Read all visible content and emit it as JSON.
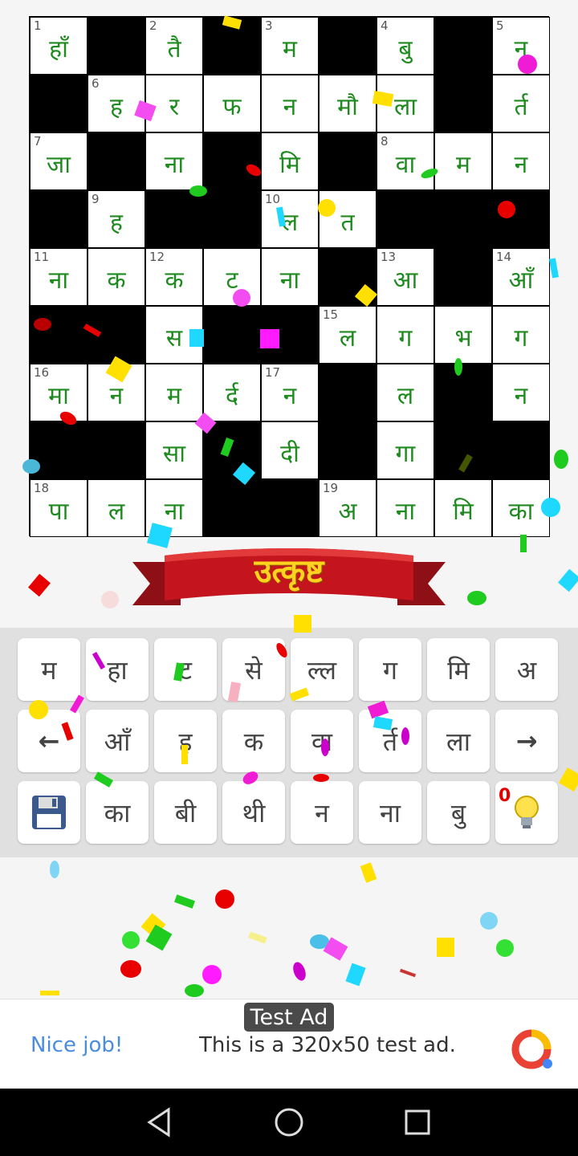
{
  "crossword": {
    "rows": [
      [
        {
          "n": "1",
          "ch": "हाँ"
        },
        null,
        {
          "n": "2",
          "ch": "तै"
        },
        null,
        {
          "n": "3",
          "ch": "म"
        },
        null,
        {
          "n": "4",
          "ch": "बु"
        },
        null,
        {
          "n": "5",
          "ch": "न"
        }
      ],
      [
        null,
        {
          "n": "6",
          "ch": "ह"
        },
        {
          "n": "",
          "ch": "र"
        },
        {
          "n": "",
          "ch": "फ"
        },
        {
          "n": "",
          "ch": "न"
        },
        {
          "n": "",
          "ch": "मौ"
        },
        {
          "n": "",
          "ch": "ला"
        },
        null,
        {
          "n": "",
          "ch": "र्त"
        }
      ],
      [
        {
          "n": "7",
          "ch": "जा"
        },
        null,
        {
          "n": "",
          "ch": "ना"
        },
        null,
        {
          "n": "",
          "ch": "मि"
        },
        null,
        {
          "n": "8",
          "ch": "वा"
        },
        {
          "n": "",
          "ch": "म"
        },
        {
          "n": "",
          "ch": "न"
        }
      ],
      [
        null,
        {
          "n": "9",
          "ch": "ह"
        },
        null,
        null,
        {
          "n": "10",
          "ch": "ल"
        },
        {
          "n": "",
          "ch": "त"
        },
        null,
        null,
        null
      ],
      [
        {
          "n": "11",
          "ch": "ना"
        },
        {
          "n": "",
          "ch": "क"
        },
        {
          "n": "12",
          "ch": "क"
        },
        {
          "n": "",
          "ch": "ट"
        },
        {
          "n": "",
          "ch": "ना"
        },
        null,
        {
          "n": "13",
          "ch": "आ"
        },
        null,
        {
          "n": "14",
          "ch": "आँ"
        }
      ],
      [
        null,
        null,
        {
          "n": "",
          "ch": "स"
        },
        null,
        null,
        {
          "n": "15",
          "ch": "ल"
        },
        {
          "n": "",
          "ch": "ग"
        },
        {
          "n": "",
          "ch": "भ"
        },
        {
          "n": "",
          "ch": "ग"
        }
      ],
      [
        {
          "n": "16",
          "ch": "मा"
        },
        {
          "n": "",
          "ch": "न"
        },
        {
          "n": "",
          "ch": "म"
        },
        {
          "n": "",
          "ch": "र्द"
        },
        {
          "n": "17",
          "ch": "न"
        },
        null,
        {
          "n": "",
          "ch": "ल"
        },
        null,
        {
          "n": "",
          "ch": "न"
        }
      ],
      [
        null,
        null,
        {
          "n": "",
          "ch": "सा"
        },
        null,
        {
          "n": "",
          "ch": "दी"
        },
        null,
        {
          "n": "",
          "ch": "गा"
        },
        null,
        null
      ],
      [
        {
          "n": "18",
          "ch": "पा"
        },
        {
          "n": "",
          "ch": "ल"
        },
        {
          "n": "",
          "ch": "ना"
        },
        null,
        null,
        {
          "n": "19",
          "ch": "अ"
        },
        {
          "n": "",
          "ch": "ना"
        },
        {
          "n": "",
          "ch": "मि"
        },
        {
          "n": "",
          "ch": "का"
        }
      ]
    ]
  },
  "banner": {
    "text": "उत्कृष्ट"
  },
  "keyboard": {
    "rows": [
      [
        "म",
        "हा",
        "ट",
        "से",
        "ल्ल",
        "ग",
        "मि",
        "अ"
      ],
      [
        "←",
        "आँ",
        "ह",
        "क",
        "वा",
        "र्त",
        "ला",
        "→"
      ],
      [
        "save",
        "का",
        "बी",
        "थी",
        "न",
        "ना",
        "बु",
        "hint"
      ]
    ],
    "hint_count": "0"
  },
  "ad": {
    "badge": "Test Ad",
    "left": "Nice job!",
    "text": "This is a 320x50 test ad."
  },
  "colors": {
    "grid_text": "#1f8a1f",
    "banner_red": "#b8121b",
    "banner_text": "#ffd21f",
    "keyboard_bg": "#e0e0e0"
  }
}
